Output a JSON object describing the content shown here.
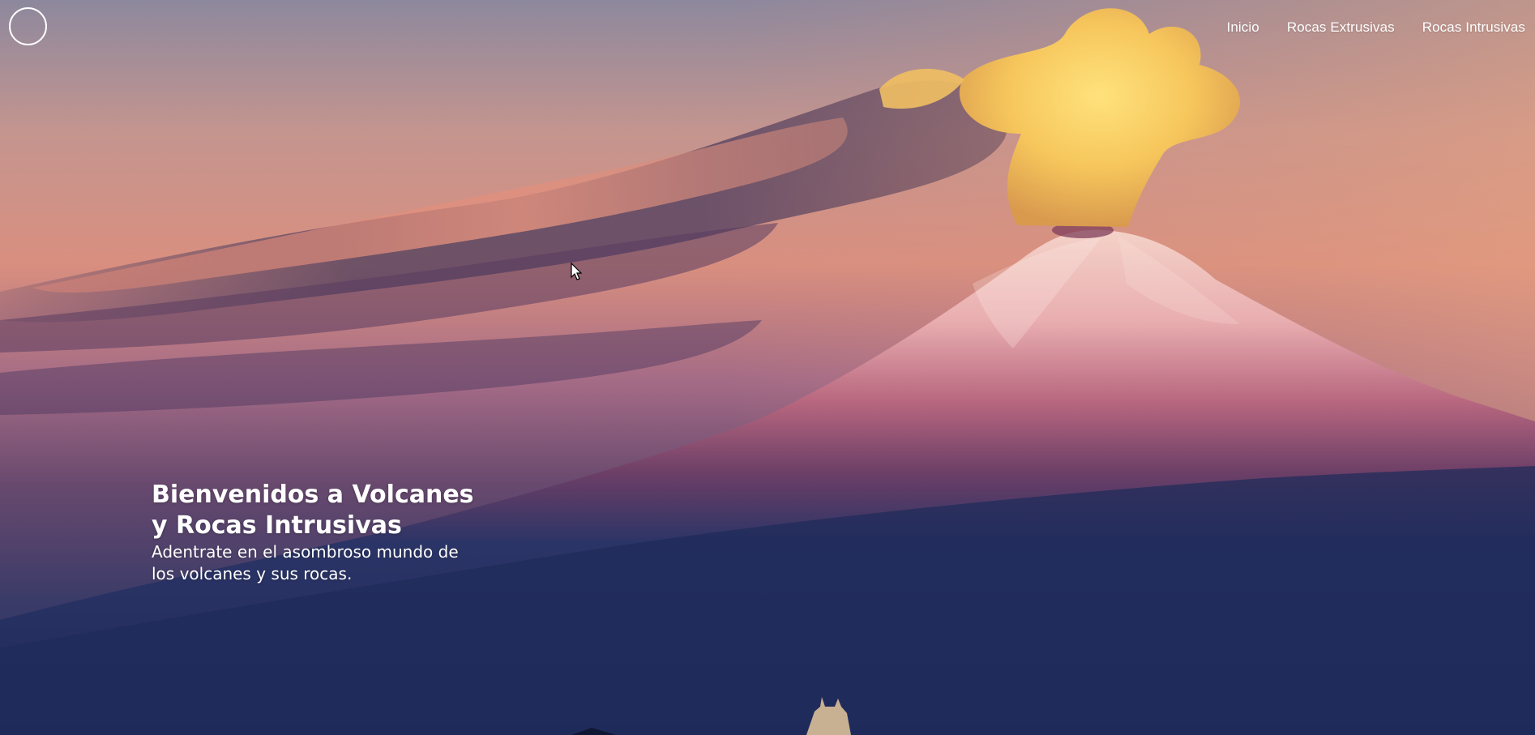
{
  "nav": {
    "logo_icon": "circle-logo-icon",
    "links": [
      {
        "label": "Inicio"
      },
      {
        "label": "Rocas Extrusivas"
      },
      {
        "label": "Rocas Intrusivas"
      }
    ]
  },
  "hero": {
    "title": "Bienvenidos a Volcanes y Rocas Intrusivas",
    "subtitle": "Adentrate en el asombroso mundo de los volcanes y sus rocas.",
    "background_image": "erupting-volcano-at-sunset",
    "colors": {
      "sky_top": "#8f8aa0",
      "sky_glow": "#e79a7a",
      "mountain_snow": "#f3cbc4",
      "plume": "#f7c85a",
      "foreground": "#243064"
    }
  },
  "pointer": "arrow-cursor-icon"
}
